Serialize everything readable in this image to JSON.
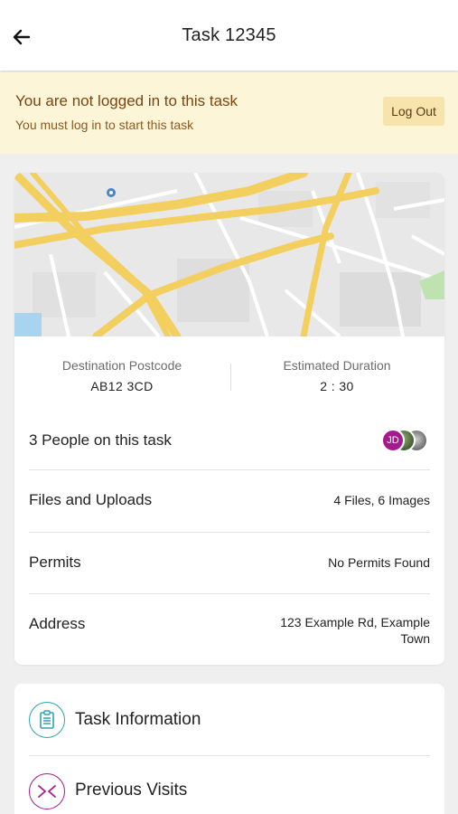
{
  "header": {
    "title": "Task 12345"
  },
  "banner": {
    "title": "You are not logged in to this task",
    "subtitle": "You must log in to start this task",
    "logout_label": "Log Out"
  },
  "summary": {
    "destination_label": "Destination Postcode",
    "destination_value": "AB12 3CD",
    "duration_label": "Estimated Duration",
    "duration_value": "2 : 30"
  },
  "details": {
    "people_label": "3 People on this task",
    "avatar_initials": "JD",
    "files_label": "Files and Uploads",
    "files_value": "4 Files, 6 Images",
    "permits_label": "Permits",
    "permits_value": "No Permits Found",
    "address_label": "Address",
    "address_line1": "123 Example Rd, Example",
    "address_line2": "Town"
  },
  "nav": {
    "task_information_label": "Task Information",
    "previous_visits_label": "Previous Visits"
  },
  "colors": {
    "banner_bg": "#fdf5d8",
    "banner_text": "#7a4510",
    "accent_teal": "#2ea3b5",
    "accent_purple": "#a51a8e"
  }
}
